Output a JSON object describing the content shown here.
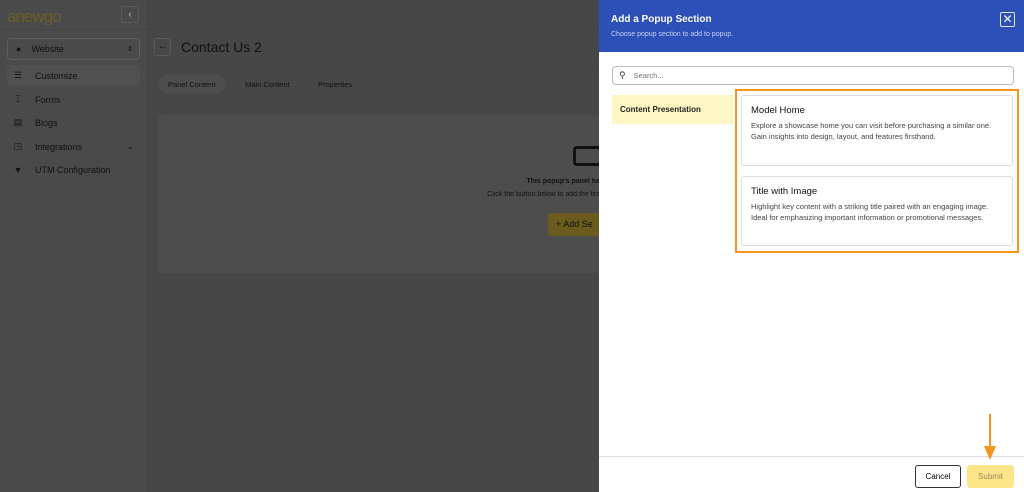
{
  "brand": {
    "logo": "anewgo"
  },
  "sidebar": {
    "site_selector": "Website",
    "items": [
      {
        "label": "Customize",
        "icon": "customize-icon"
      },
      {
        "label": "Forms",
        "icon": "forms-icon"
      },
      {
        "label": "Blogs",
        "icon": "blogs-icon"
      },
      {
        "label": "Integrations",
        "icon": "integrations-icon"
      },
      {
        "label": "UTM Configuration",
        "icon": "utm-icon"
      }
    ]
  },
  "main": {
    "title": "Contact Us 2",
    "tabs": [
      {
        "label": "Panel Content"
      },
      {
        "label": "Main Content"
      },
      {
        "label": "Properties"
      }
    ],
    "empty_title": "This popup's panel ha",
    "empty_desc": "Click the button below to add the firs",
    "add_button": "+ Add Se"
  },
  "drawer": {
    "title": "Add a Popup Section",
    "subtitle": "Choose popup section to add to popup.",
    "search_placeholder": "Search...",
    "categories": [
      {
        "label": "Content Presentation"
      }
    ],
    "sections": [
      {
        "title": "Model Home",
        "desc": "Explore a showcase home you can visit before purchasing a similar one. Gain insights into design, layout, and features firsthand."
      },
      {
        "title": "Title with Image",
        "desc": "Highlight key content with a striking title paired with an engaging image. Ideal for emphasizing important information or promotional messages."
      }
    ],
    "cancel": "Cancel",
    "submit": "Submit"
  },
  "colors": {
    "header": "#2d50b8",
    "highlight": "#f7941d",
    "category_bg": "#fef7c3",
    "submit_bg": "#fde68a"
  }
}
